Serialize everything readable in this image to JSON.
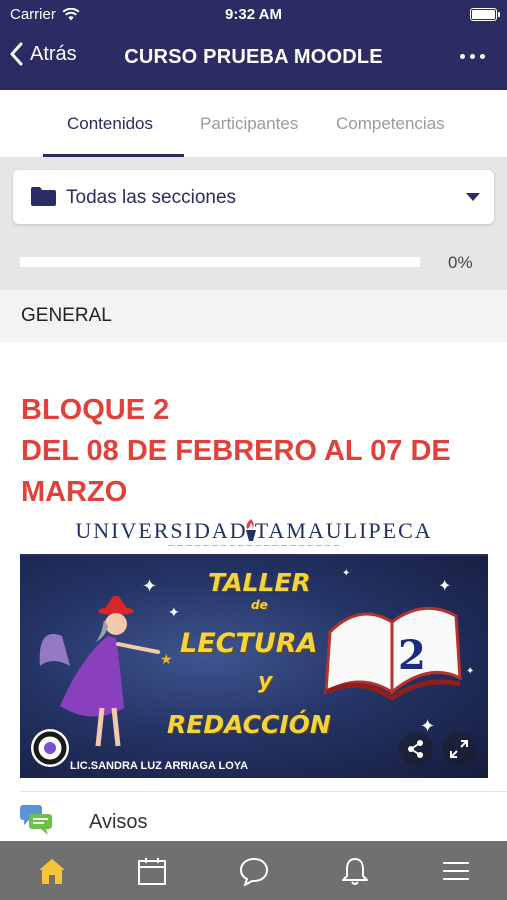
{
  "status_bar": {
    "carrier": "Carrier",
    "time": "9:32 AM"
  },
  "header": {
    "back_label": "Atrás",
    "title": "CURSO PRUEBA MOODLE"
  },
  "tabs": [
    {
      "label": "Contenidos",
      "active": true
    },
    {
      "label": "Participantes",
      "active": false
    },
    {
      "label": "Competencias",
      "active": false
    }
  ],
  "section_selector": {
    "label": "Todas las secciones"
  },
  "progress": {
    "value": 0,
    "label": "0%"
  },
  "section": {
    "name": "GENERAL"
  },
  "content": {
    "block_title_line1": "BLOQUE 2",
    "block_title_line2": "DEL 08 DE FEBRERO AL 07 DE MARZO"
  },
  "banner": {
    "university": "UNIVERSIDAD TAMAULIPECA",
    "word1": "TALLER",
    "word2": "de",
    "word3": "LECTURA",
    "word4": "y",
    "word5": "REDACCIÓN",
    "number": "2",
    "credit": "LIC.SANDRA LUZ ARRIAGA LOYA"
  },
  "activity": {
    "label": "Avisos"
  },
  "colors": {
    "primary": "#2b2c64",
    "accent_red": "#e0413a",
    "tabbar": "#707070",
    "home_active": "#f4c53b"
  },
  "bottom_nav": [
    "home-icon",
    "calendar-icon",
    "chat-icon",
    "bell-icon",
    "menu-icon"
  ]
}
